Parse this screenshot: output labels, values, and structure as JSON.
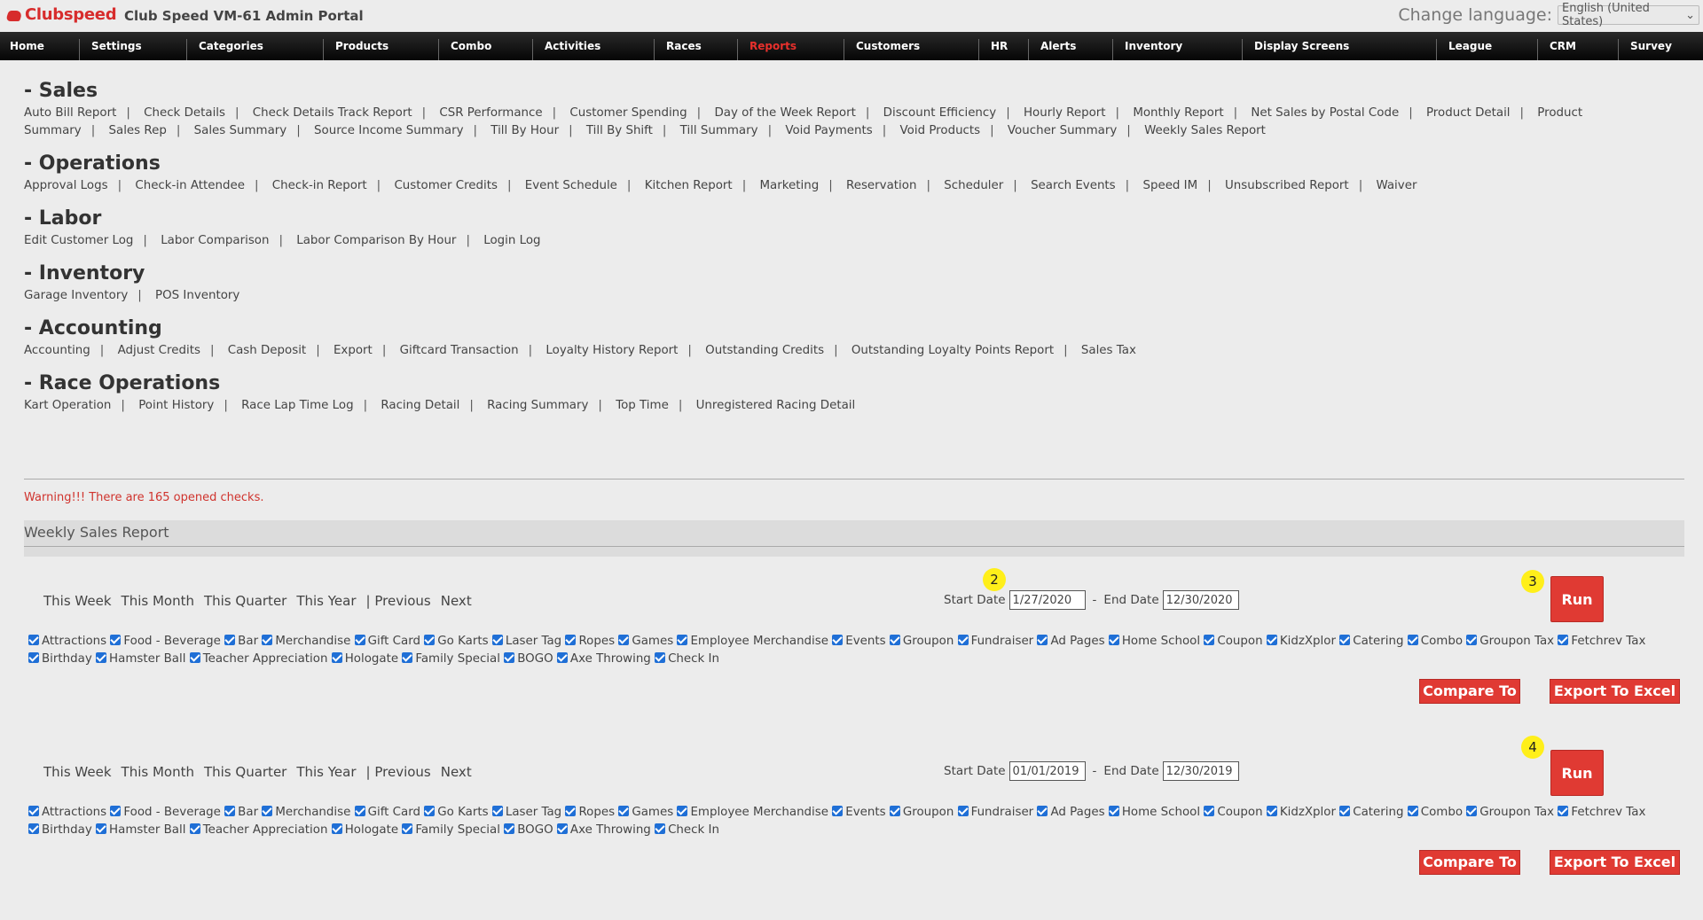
{
  "header": {
    "logo": "Clubspeed",
    "title": "Club Speed VM-61 Admin Portal",
    "language_label": "Change language:",
    "language_value": "English (United States)"
  },
  "nav": [
    {
      "label": "Home"
    },
    {
      "label": "Settings"
    },
    {
      "label": "Categories"
    },
    {
      "label": "Products"
    },
    {
      "label": "Combo"
    },
    {
      "label": "Activities"
    },
    {
      "label": "Races"
    },
    {
      "label": "Reports",
      "active": true
    },
    {
      "label": "Customers"
    },
    {
      "label": "HR"
    },
    {
      "label": "Alerts"
    },
    {
      "label": "Inventory"
    },
    {
      "label": "Display Screens"
    },
    {
      "label": "League"
    },
    {
      "label": "CRM"
    },
    {
      "label": "Survey"
    }
  ],
  "sections": [
    {
      "title": "- Sales",
      "links": [
        "Auto Bill Report",
        "Check Details",
        "Check Details Track Report",
        "CSR Performance",
        "Customer Spending",
        "Day of the Week Report",
        "Discount Efficiency",
        "Hourly Report",
        "Monthly Report",
        "Net Sales by Postal Code",
        "Product Detail",
        "Product Summary",
        "Sales Rep",
        "Sales Summary",
        "Source Income Summary",
        "Till By Hour",
        "Till By Shift",
        "Till Summary",
        "Void Payments",
        "Void Products",
        "Voucher Summary",
        "Weekly Sales Report"
      ]
    },
    {
      "title": "- Operations",
      "links": [
        "Approval Logs",
        "Check-in Attendee",
        "Check-in Report",
        "Customer Credits",
        "Event Schedule",
        "Kitchen Report",
        "Marketing",
        "Reservation",
        "Scheduler",
        "Search Events",
        "Speed IM",
        "Unsubscribed Report",
        "Waiver"
      ]
    },
    {
      "title": "- Labor",
      "links": [
        "Edit Customer Log",
        "Labor Comparison",
        "Labor Comparison By Hour",
        "Login Log"
      ]
    },
    {
      "title": "- Inventory",
      "links": [
        "Garage Inventory",
        "POS Inventory"
      ]
    },
    {
      "title": "- Accounting",
      "links": [
        "Accounting",
        "Adjust Credits",
        "Cash Deposit",
        "Export",
        "Giftcard Transaction",
        "Loyalty History Report",
        "Outstanding Credits",
        "Outstanding Loyalty Points Report",
        "Sales Tax"
      ]
    },
    {
      "title": "- Race Operations",
      "links": [
        "Kart Operation",
        "Point History",
        "Race Lap Time Log",
        "Racing Detail",
        "Racing Summary",
        "Top Time",
        "Unregistered Racing Detail"
      ]
    }
  ],
  "warning": "Warning!!! There are 165 opened checks.",
  "report_title": "Weekly Sales Report",
  "quick_ranges": [
    "This Week",
    "This Month",
    "This Quarter",
    "This Year",
    "| Previous",
    "Next"
  ],
  "start_date_label": "Start Date",
  "end_date_label": "End Date",
  "date_dash": "-",
  "run_label": "Run",
  "compare_label": "Compare To",
  "export_label": "Export To Excel",
  "filters": [
    {
      "badge": "2",
      "start": "1/27/2020",
      "end": "12/30/2020",
      "run_badge": "3"
    },
    {
      "badge": "",
      "start": "01/01/2019",
      "end": "12/30/2019",
      "run_badge": "4"
    }
  ],
  "categories": [
    "Attractions",
    "Food - Beverage",
    "Bar",
    "Merchandise",
    "Gift Card",
    "Go Karts",
    "Laser Tag",
    "Ropes",
    "Games",
    "Employee Merchandise",
    "Events",
    "Groupon",
    "Fundraiser",
    "Ad Pages",
    "Home School",
    "Coupon",
    "KidzXplor",
    "Catering",
    "Combo",
    "Groupon Tax",
    "Fetchrev Tax",
    "Birthday",
    "Hamster Ball",
    "Teacher Appreciation",
    "Hologate",
    "Family Special",
    "BOGO",
    "Axe Throwing",
    "Check In"
  ]
}
